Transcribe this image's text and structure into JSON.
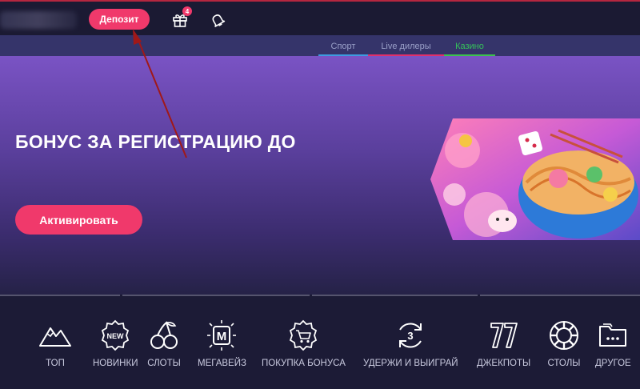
{
  "header": {
    "deposit_label": "Депозит",
    "gift_badge": "4",
    "icons": [
      "gift-icon",
      "bell-icon"
    ]
  },
  "subnav": {
    "items": [
      {
        "label": "Спорт",
        "color": "#3d9be0"
      },
      {
        "label": "Live дилеры",
        "color": "#e0306b"
      },
      {
        "label": "Казино",
        "color": "#3bc24e"
      }
    ]
  },
  "hero": {
    "title": "БОНУС ЗА РЕГИСТРАЦИЮ ДО",
    "button_label": "Активировать"
  },
  "categories": [
    {
      "label": "ТОП",
      "icon": "mountain-icon"
    },
    {
      "label": "НОВИНКИ",
      "icon": "new-badge-icon"
    },
    {
      "label": "СЛОТЫ",
      "icon": "cherries-icon"
    },
    {
      "label": "МЕГАВЕЙЗ",
      "icon": "megaways-icon"
    },
    {
      "label": "ПОКУПКА БОНУСА",
      "icon": "bonus-cart-icon"
    },
    {
      "label": "УДЕРЖИ И ВЫИГРАЙ",
      "icon": "hold-win-icon"
    },
    {
      "label": "ДЖЕКПОТЫ",
      "icon": "seven-icon"
    },
    {
      "label": "СТОЛЫ",
      "icon": "chip-icon"
    },
    {
      "label": "ДРУГОЕ",
      "icon": "folder-icon"
    }
  ],
  "colors": {
    "accent": "#f0396b",
    "background": "#1c1b36"
  }
}
